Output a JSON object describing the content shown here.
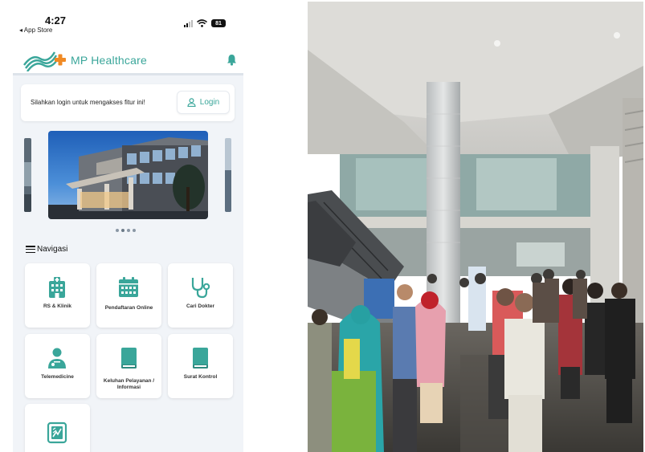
{
  "status_bar": {
    "time": "4:27",
    "back_label": "◂ App Store",
    "battery": "81"
  },
  "header": {
    "brand": "MP Healthcare",
    "logo_icon": "mp-healthcare-logo",
    "bell_icon": "bell-icon"
  },
  "login_card": {
    "message": "Silahkan login untuk mengakses fitur ini!",
    "button_label": "Login",
    "button_icon": "user-icon"
  },
  "carousel": {
    "slide_count": 4,
    "active_index": 1
  },
  "navigation": {
    "title": "Navigasi",
    "items": [
      {
        "label": "RS & Klinik",
        "icon": "hospital-building-icon"
      },
      {
        "label": "Pendaftaran Online",
        "icon": "calendar-icon"
      },
      {
        "label": "Cari Dokter",
        "icon": "stethoscope-icon"
      },
      {
        "label": "Telemedicine",
        "icon": "doctor-icon"
      },
      {
        "label": "Keluhan Pelayanan / Informasi",
        "icon": "book-icon"
      },
      {
        "label": "Surat Kontrol",
        "icon": "document-icon"
      },
      {
        "label": "",
        "icon": "xray-icon"
      }
    ]
  },
  "colors": {
    "accent": "#3aa69a",
    "app_background": "#f1f4f8",
    "card": "#ffffff"
  }
}
